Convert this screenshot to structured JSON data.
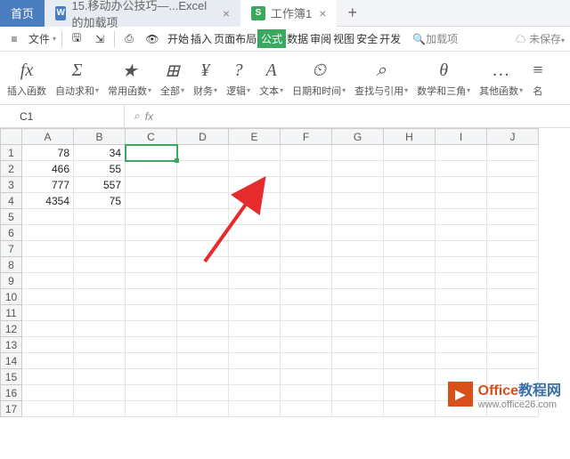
{
  "colors": {
    "primary_blue": "#4a7dbf",
    "primary_green": "#3ba860",
    "accent_orange": "#d94f1a"
  },
  "tabs": {
    "home": "首页",
    "doc1_icon": "W",
    "doc1_label": "15.移动办公技巧—...Excel 的加载项",
    "doc2_icon": "S",
    "doc2_label": "工作簿1",
    "close_glyph": "×",
    "plus_glyph": "+"
  },
  "menu": {
    "file": "文件",
    "tabs": [
      "开始",
      "插入",
      "页面布局",
      "公式",
      "数据",
      "审阅",
      "视图",
      "安全",
      "开发"
    ],
    "active_tab_index": 3,
    "search_placeholder": "加载项",
    "unsaved": "未保存"
  },
  "ribbon": [
    {
      "icon": "fx",
      "label": "插入函数",
      "dd": false
    },
    {
      "icon": "Σ",
      "label": "自动求和",
      "dd": true
    },
    {
      "icon": "★",
      "label": "常用函数",
      "dd": true
    },
    {
      "icon": "⊞",
      "label": "全部",
      "dd": true
    },
    {
      "icon": "¥",
      "label": "财务",
      "dd": true
    },
    {
      "icon": "?",
      "label": "逻辑",
      "dd": true
    },
    {
      "icon": "A",
      "label": "文本",
      "dd": true
    },
    {
      "icon": "⏲",
      "label": "日期和时间",
      "dd": true
    },
    {
      "icon": "⌕",
      "label": "查找与引用",
      "dd": true
    },
    {
      "icon": "θ",
      "label": "数学和三角",
      "dd": true
    },
    {
      "icon": "…",
      "label": "其他函数",
      "dd": true
    },
    {
      "icon": "≡",
      "label": "名",
      "dd": false
    }
  ],
  "name_box": "C1",
  "fx_label": "fx",
  "columns": [
    "A",
    "B",
    "C",
    "D",
    "E",
    "F",
    "G",
    "H",
    "I",
    "J"
  ],
  "row_count": 17,
  "selected": {
    "row": 1,
    "col": "C"
  },
  "cells": {
    "r1": {
      "A": "78",
      "B": "34"
    },
    "r2": {
      "A": "466",
      "B": "55"
    },
    "r3": {
      "A": "777",
      "B": "557"
    },
    "r4": {
      "A": "4354",
      "B": "75"
    }
  },
  "watermark": {
    "logo_glyph": "▶",
    "t1": "Office",
    "t2": "教程网",
    "site": "www.office26.com"
  }
}
